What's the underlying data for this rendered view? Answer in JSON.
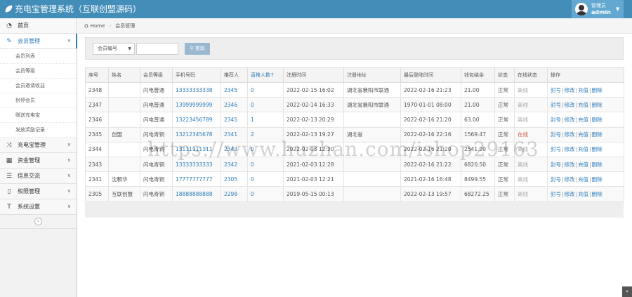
{
  "header": {
    "title": "充电宝管理系统（互联创盟源码）",
    "user_role": "管理员",
    "user_name": "admin"
  },
  "sidebar": {
    "items": [
      {
        "label": "首页",
        "icon": "dashboard-icon"
      },
      {
        "label": "会员管理",
        "icon": "edit-icon",
        "expanded": true
      },
      {
        "label": "充电宝管理",
        "icon": "shuffle-icon"
      },
      {
        "label": "资金管理",
        "icon": "calendar-icon"
      },
      {
        "label": "信息交流",
        "icon": "list-icon"
      },
      {
        "label": "权限管理",
        "icon": "file-icon"
      },
      {
        "label": "系统设置",
        "icon": "text-icon"
      }
    ],
    "sub_items": [
      "会员列表",
      "会员等级",
      "会员邀请收益",
      "封停会员",
      "赠送充电宝",
      "发放奖励记录"
    ],
    "collapse": "«"
  },
  "breadcrumb": {
    "home": "Home",
    "current": "会员管理"
  },
  "search": {
    "select_value": "会员编号",
    "button_label": "查询"
  },
  "table": {
    "headers": [
      "序号",
      "姓名",
      "会员等级",
      "手机号码",
      "推荐人",
      "直推人数↑",
      "注册时间",
      "注册地址",
      "最后登陆时间",
      "钱包结余",
      "状态",
      "在线状态",
      "操作"
    ],
    "rows": [
      {
        "id": "2348",
        "name": "",
        "level": "闪电普通",
        "phone": "13333333338",
        "referrer": "2345",
        "direct": "0",
        "reg_time": "2022-02-15 16:02",
        "reg_addr": "湖北省襄阳市联通",
        "last_login": "2022-02-16 21:23",
        "wallet": "21.00",
        "status": "正常",
        "online": "离线"
      },
      {
        "id": "2347",
        "name": "",
        "level": "闪电普通",
        "phone": "13999999999",
        "referrer": "2346",
        "direct": "0",
        "reg_time": "2022-02-14 16:33",
        "reg_addr": "湖北省襄阳市联通",
        "last_login": "1970-01-01 08:00",
        "wallet": "21.00",
        "status": "正常",
        "online": "离线"
      },
      {
        "id": "2346",
        "name": "",
        "level": "闪电普通",
        "phone": "13223456789",
        "referrer": "2345",
        "direct": "1",
        "reg_time": "2022-02-13 20:29",
        "reg_addr": "",
        "last_login": "2022-02-16 21:20",
        "wallet": "63.00",
        "status": "正常",
        "online": "离线"
      },
      {
        "id": "2345",
        "name": "创盟",
        "level": "闪电青铜",
        "phone": "13212345678",
        "referrer": "2341",
        "direct": "2",
        "reg_time": "2022-02-13 19:27",
        "reg_addr": "湖北省",
        "last_login": "2022-02-16 22:16",
        "wallet": "1569.47",
        "status": "正常",
        "online": "在线"
      },
      {
        "id": "2344",
        "name": "",
        "level": "闪电青铜",
        "phone": "13111111111",
        "referrer": "2343",
        "direct": "0",
        "reg_time": "2022-02-03 12:30",
        "reg_addr": "",
        "last_login": "2022-02-16 21:20",
        "wallet": "2541.00",
        "status": "正常",
        "online": "离线"
      },
      {
        "id": "2343",
        "name": "",
        "level": "闪电青铜",
        "phone": "13333333333",
        "referrer": "2342",
        "direct": "0",
        "reg_time": "2021-02-03 12:28",
        "reg_addr": "",
        "last_login": "2022-02-16 21:22",
        "wallet": "6820.50",
        "status": "正常",
        "online": "离线"
      },
      {
        "id": "2341",
        "name": "沈颗华",
        "level": "闪电青铜",
        "phone": "17777777777",
        "referrer": "2305",
        "direct": "0",
        "reg_time": "2021-02-03 12:21",
        "reg_addr": "",
        "last_login": "2021-02-16 16:48",
        "wallet": "8499.55",
        "status": "正常",
        "online": "离线"
      },
      {
        "id": "2305",
        "name": "互联创盟",
        "level": "闪电青铜",
        "phone": "18888888888",
        "referrer": "2298",
        "direct": "0",
        "reg_time": "2019-05-15 00:13",
        "reg_addr": "",
        "last_login": "2022-02-13 19:57",
        "wallet": "68272.25",
        "status": "正常",
        "online": "离线"
      }
    ],
    "actions": [
      "封号",
      "修改",
      "充值",
      "删除"
    ]
  },
  "watermark": "https://www.huzhan.com/ishop29163",
  "scroll_top": "»",
  "colors": {
    "navbar": "#438eb9",
    "link": "#2b7dbc",
    "online": "#d15b47"
  }
}
